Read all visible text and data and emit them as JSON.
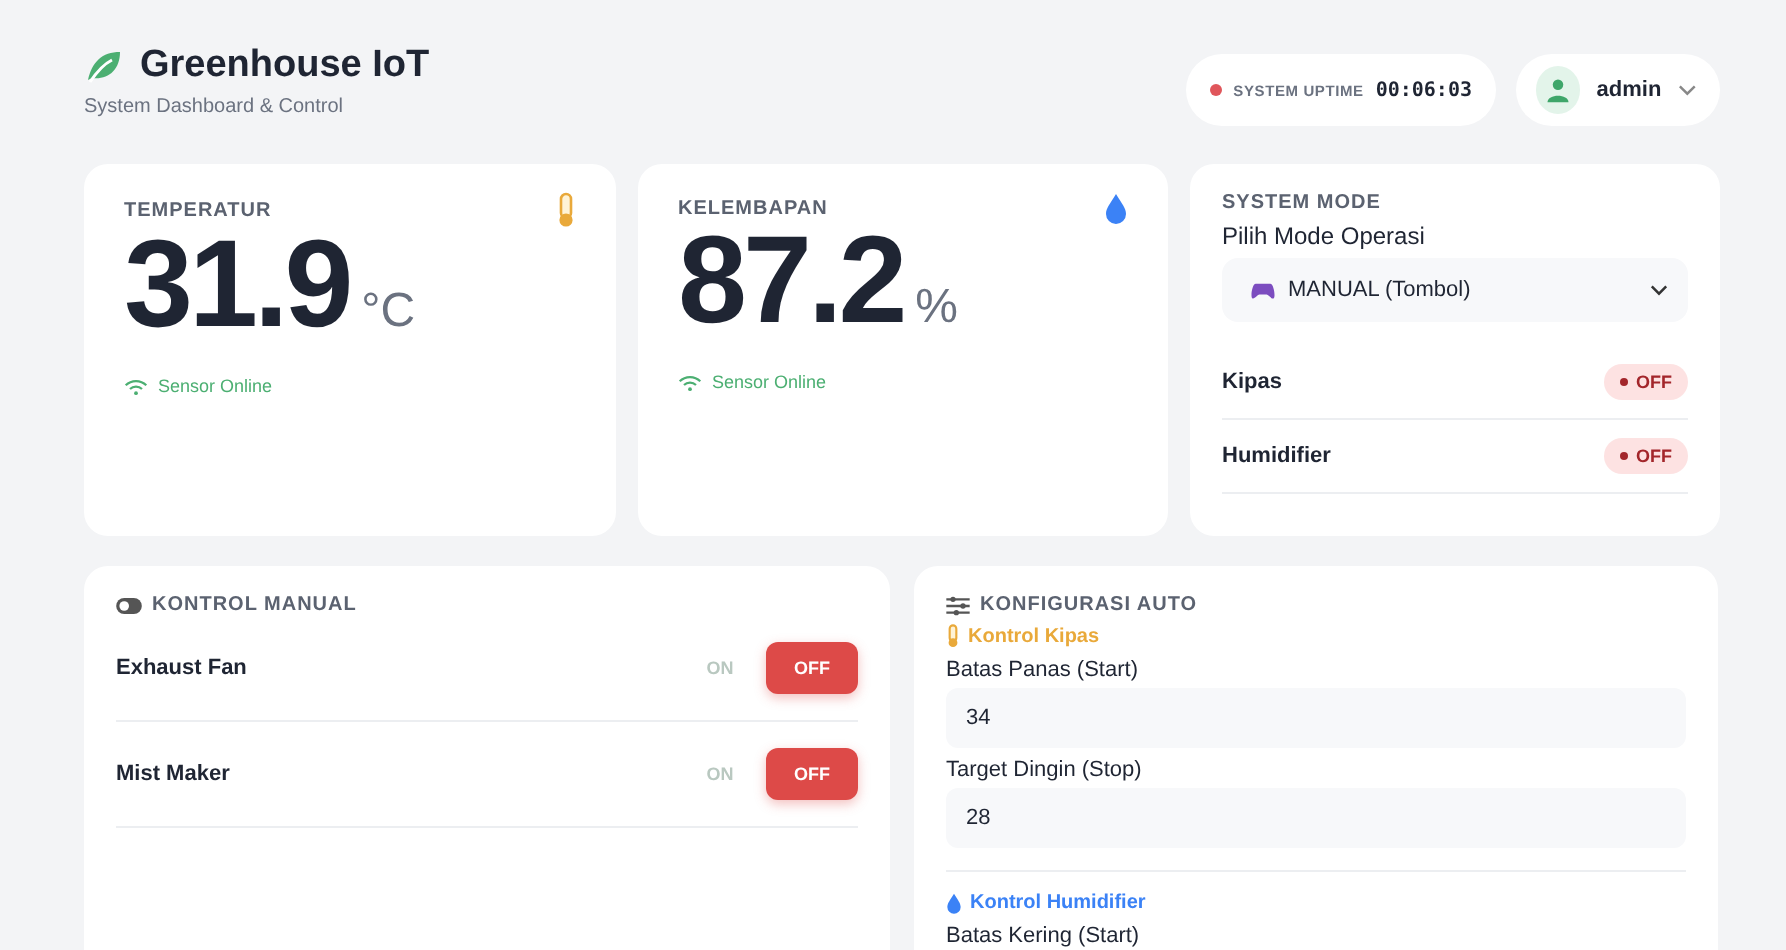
{
  "header": {
    "title": "Greenhouse IoT",
    "subtitle": "System Dashboard & Control",
    "uptime_label": "SYSTEM UPTIME",
    "uptime": "00:06:03",
    "user": "admin"
  },
  "sensors": [
    {
      "kind": "temperature",
      "label": "TEMPERATUR",
      "value": "31.9",
      "unit": "°C",
      "status": "Sensor Online"
    },
    {
      "kind": "humidity",
      "label": "KELEMBAPAN",
      "value": "87.2",
      "unit": "%",
      "status": "Sensor Online"
    }
  ],
  "system_mode": {
    "title": "SYSTEM MODE",
    "select_label": "Pilih Mode Operasi",
    "select_value": "MANUAL (Tombol)",
    "devices": [
      {
        "name": "Kipas",
        "state": "OFF",
        "on": false
      },
      {
        "name": "Humidifier",
        "state": "OFF",
        "on": false
      }
    ]
  },
  "manual_control": {
    "title": "KONTROL MANUAL",
    "devices": [
      {
        "name": "Exhaust Fan",
        "on_label": "ON",
        "off_label": "OFF",
        "on": false
      },
      {
        "name": "Mist Maker",
        "on_label": "ON",
        "off_label": "OFF",
        "on": false
      }
    ]
  },
  "auto_config": {
    "title": "KONFIGURASI AUTO",
    "sections": [
      {
        "kind": "fan",
        "title": "Kontrol Kipas",
        "fields": [
          {
            "label": "Batas Panas (Start)",
            "value": "34"
          },
          {
            "label": "Target Dingin (Stop)",
            "value": "28"
          }
        ]
      },
      {
        "kind": "humidifier",
        "title": "Kontrol Humidifier",
        "fields": [
          {
            "label": "Batas Kering (Start)"
          }
        ]
      }
    ]
  }
}
